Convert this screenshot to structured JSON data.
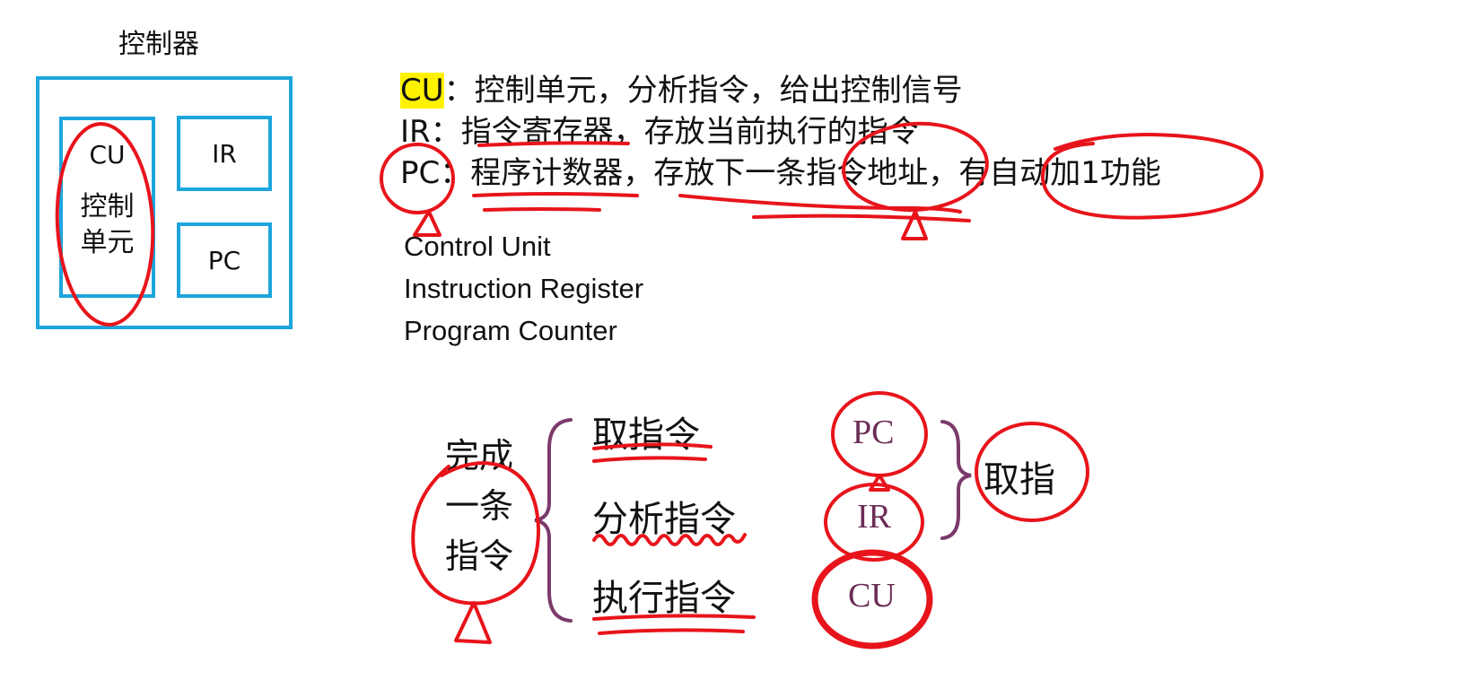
{
  "controller": {
    "title": "控制器",
    "cu_label": "CU",
    "cu_desc": "控制单元",
    "ir_label": "IR",
    "pc_label": "PC",
    "box_color": "#1da5dd"
  },
  "definitions": {
    "cu": {
      "abbr": "CU",
      "sep": "：",
      "text": "控制单元，分析指令，给出控制信号"
    },
    "ir": {
      "abbr": "IR",
      "sep": "：",
      "text": "指令寄存器，存放当前执行的指令"
    },
    "pc": {
      "abbr": "PC",
      "sep": "：",
      "text": "程序计数器，存放下一条指令地址，有自动加1功能"
    },
    "highlight_color": "#fff200"
  },
  "english": {
    "cu": "Control Unit",
    "ir": "Instruction Register",
    "pc": "Program Counter"
  },
  "steps": {
    "complete_label": "完成一条指令",
    "fetch": "取指令",
    "analyze": "分析指令",
    "execute": "执行指令",
    "reg_pc": "PC",
    "reg_ir": "IR",
    "reg_cu": "CU",
    "fetch_summary": "取指",
    "brace_color": "#7b3a6a",
    "reg_color": "#6b2d55"
  },
  "annotation_color": "#e8141b"
}
